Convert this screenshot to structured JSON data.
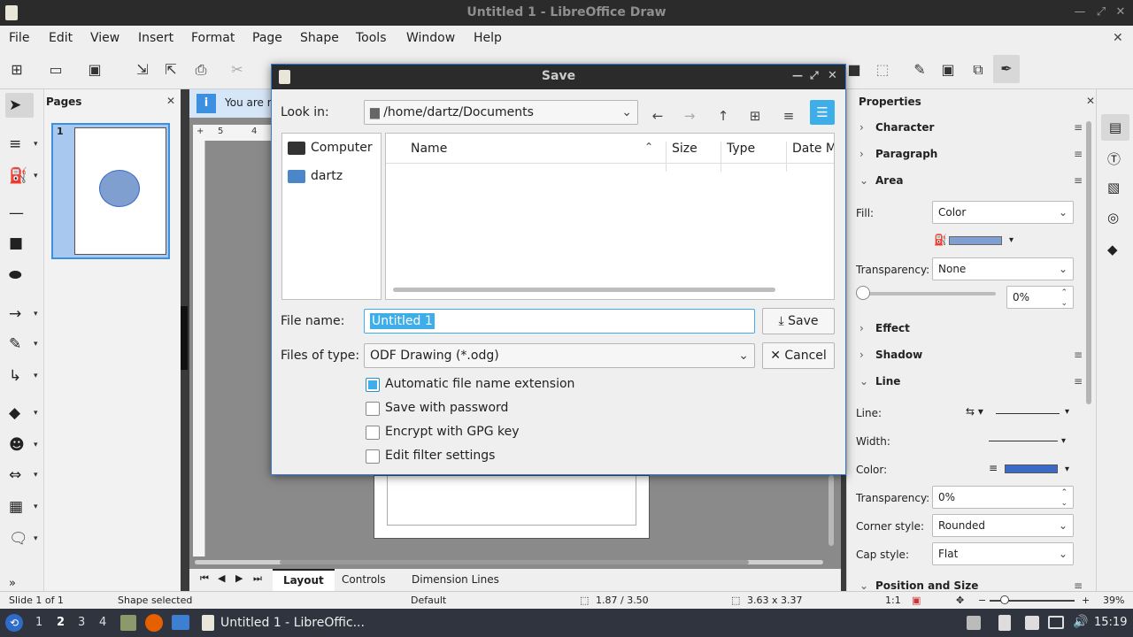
{
  "window": {
    "title": "Untitled 1 - LibreOffice Draw"
  },
  "menu": [
    "File",
    "Edit",
    "View",
    "Insert",
    "Format",
    "Page",
    "Shape",
    "Tools",
    "Window",
    "Help"
  ],
  "pages_panel": {
    "title": "Pages",
    "page_number": "1"
  },
  "infobar": {
    "text": "You are r"
  },
  "sidebar": {
    "title": "Properties",
    "sections": {
      "character": "Character",
      "paragraph": "Paragraph",
      "area": "Area",
      "effect": "Effect",
      "shadow": "Shadow",
      "line": "Line",
      "position": "Position and Size"
    },
    "fill_label": "Fill:",
    "fill_value": "Color",
    "transparency_label": "Transparency:",
    "transparency_value": "None",
    "transparency_pct": "0%",
    "line_label": "Line:",
    "width_label": "Width:",
    "color_label": "Color:",
    "line_transparency_label": "Transparency:",
    "line_transparency_value": "0%",
    "corner_label": "Corner style:",
    "corner_value": "Rounded",
    "cap_label": "Cap style:",
    "cap_value": "Flat",
    "fill_color": "#7f9fd0",
    "line_color": "#3c6ac6"
  },
  "tabs": {
    "layout": "Layout",
    "controls": "Controls",
    "dimension": "Dimension Lines"
  },
  "status": {
    "slide": "Slide 1 of 1",
    "selection": "Shape selected",
    "style": "Default",
    "position": "1.87 / 3.50",
    "size": "3.63 x 3.37",
    "scale": "1:1",
    "zoom": "39%"
  },
  "taskbar": {
    "workspaces": [
      "1",
      "2",
      "3",
      "4"
    ],
    "active_workspace": "2",
    "app_title": "Untitled 1 - LibreOffic...",
    "clock": "15:19"
  },
  "dialog": {
    "title": "Save",
    "look_in_label": "Look in:",
    "look_in_value": "/home/dartz/Documents",
    "places": [
      "Computer",
      "dartz"
    ],
    "columns": [
      "Name",
      "Size",
      "Type",
      "Date M"
    ],
    "file_name_label": "File name:",
    "file_name_value": "Untitled 1",
    "save_button": "Save",
    "type_label": "Files of type:",
    "type_value": "ODF Drawing (*.odg)",
    "cancel_button": "Cancel",
    "options": [
      {
        "label": "Automatic file name extension",
        "checked": true
      },
      {
        "label": "Save with password",
        "checked": false
      },
      {
        "label": "Encrypt with GPG key",
        "checked": false
      },
      {
        "label": "Edit filter settings",
        "checked": false
      }
    ]
  }
}
